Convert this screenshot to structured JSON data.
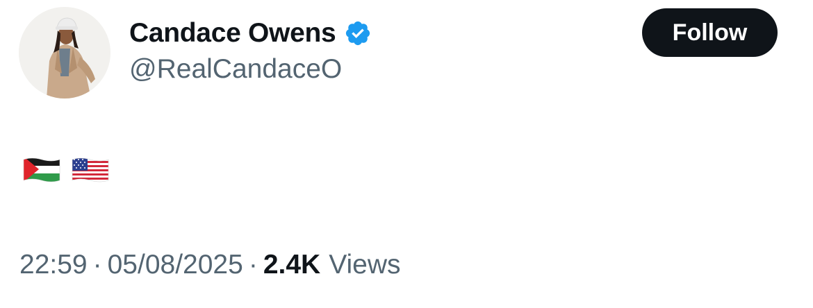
{
  "author": {
    "display_name": "Candace Owens",
    "handle": "@RealCandaceO",
    "verified": true,
    "avatar_icon": "profile-photo"
  },
  "follow_button": {
    "label": "Follow"
  },
  "tweet": {
    "content_emoji": [
      "palestine-flag",
      "us-flag"
    ]
  },
  "meta": {
    "time": "22:59",
    "separator": "·",
    "date": "05/08/2025",
    "views_count": "2.4K",
    "views_label": "Views"
  },
  "colors": {
    "text_primary": "#0f1419",
    "text_secondary": "#536471",
    "verified_blue": "#1d9bf0",
    "button_bg": "#0f1419"
  }
}
